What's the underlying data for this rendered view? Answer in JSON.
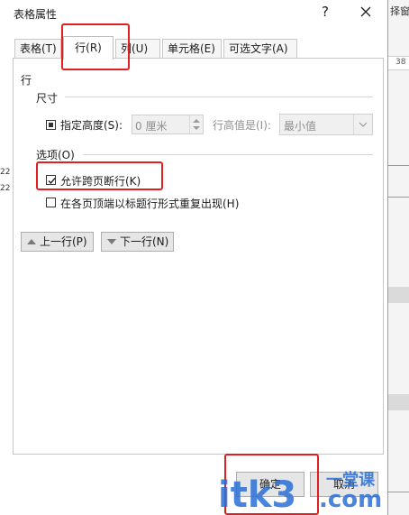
{
  "background": {
    "header_fragment": "择窗",
    "ruler_value": "38",
    "left_row_fragments": [
      "22",
      "22"
    ]
  },
  "dialog": {
    "title": "表格属性",
    "help_label": "?",
    "tabs": [
      {
        "label": "表格(T)",
        "active": false
      },
      {
        "label": "行(R)",
        "active": true
      },
      {
        "label": "列(U)",
        "active": false
      },
      {
        "label": "单元格(E)",
        "active": false
      },
      {
        "label": "可选文字(A)",
        "active": false
      }
    ],
    "row_section_title": "行",
    "size_section_title": "尺寸",
    "specify_height_label": "指定高度(S):",
    "height_value": "0 厘米",
    "row_height_is_label": "行高值是(I):",
    "row_height_rule": "最小值",
    "options_section_title": "选项(O)",
    "allow_break_label": "允许跨页断行(K)",
    "repeat_header_label": "在各页顶端以标题行形式重复出现(H)",
    "prev_row_label": "上一行(P)",
    "next_row_label": "下一行(N)",
    "ok_label": "确定",
    "cancel_label": "取消"
  },
  "watermark": {
    "brand": "itk3",
    "suffix": ".com",
    "tagline": "一堂课"
  },
  "colors": {
    "highlight_red": "#e02020",
    "watermark_blue": "#2b6fd6"
  }
}
